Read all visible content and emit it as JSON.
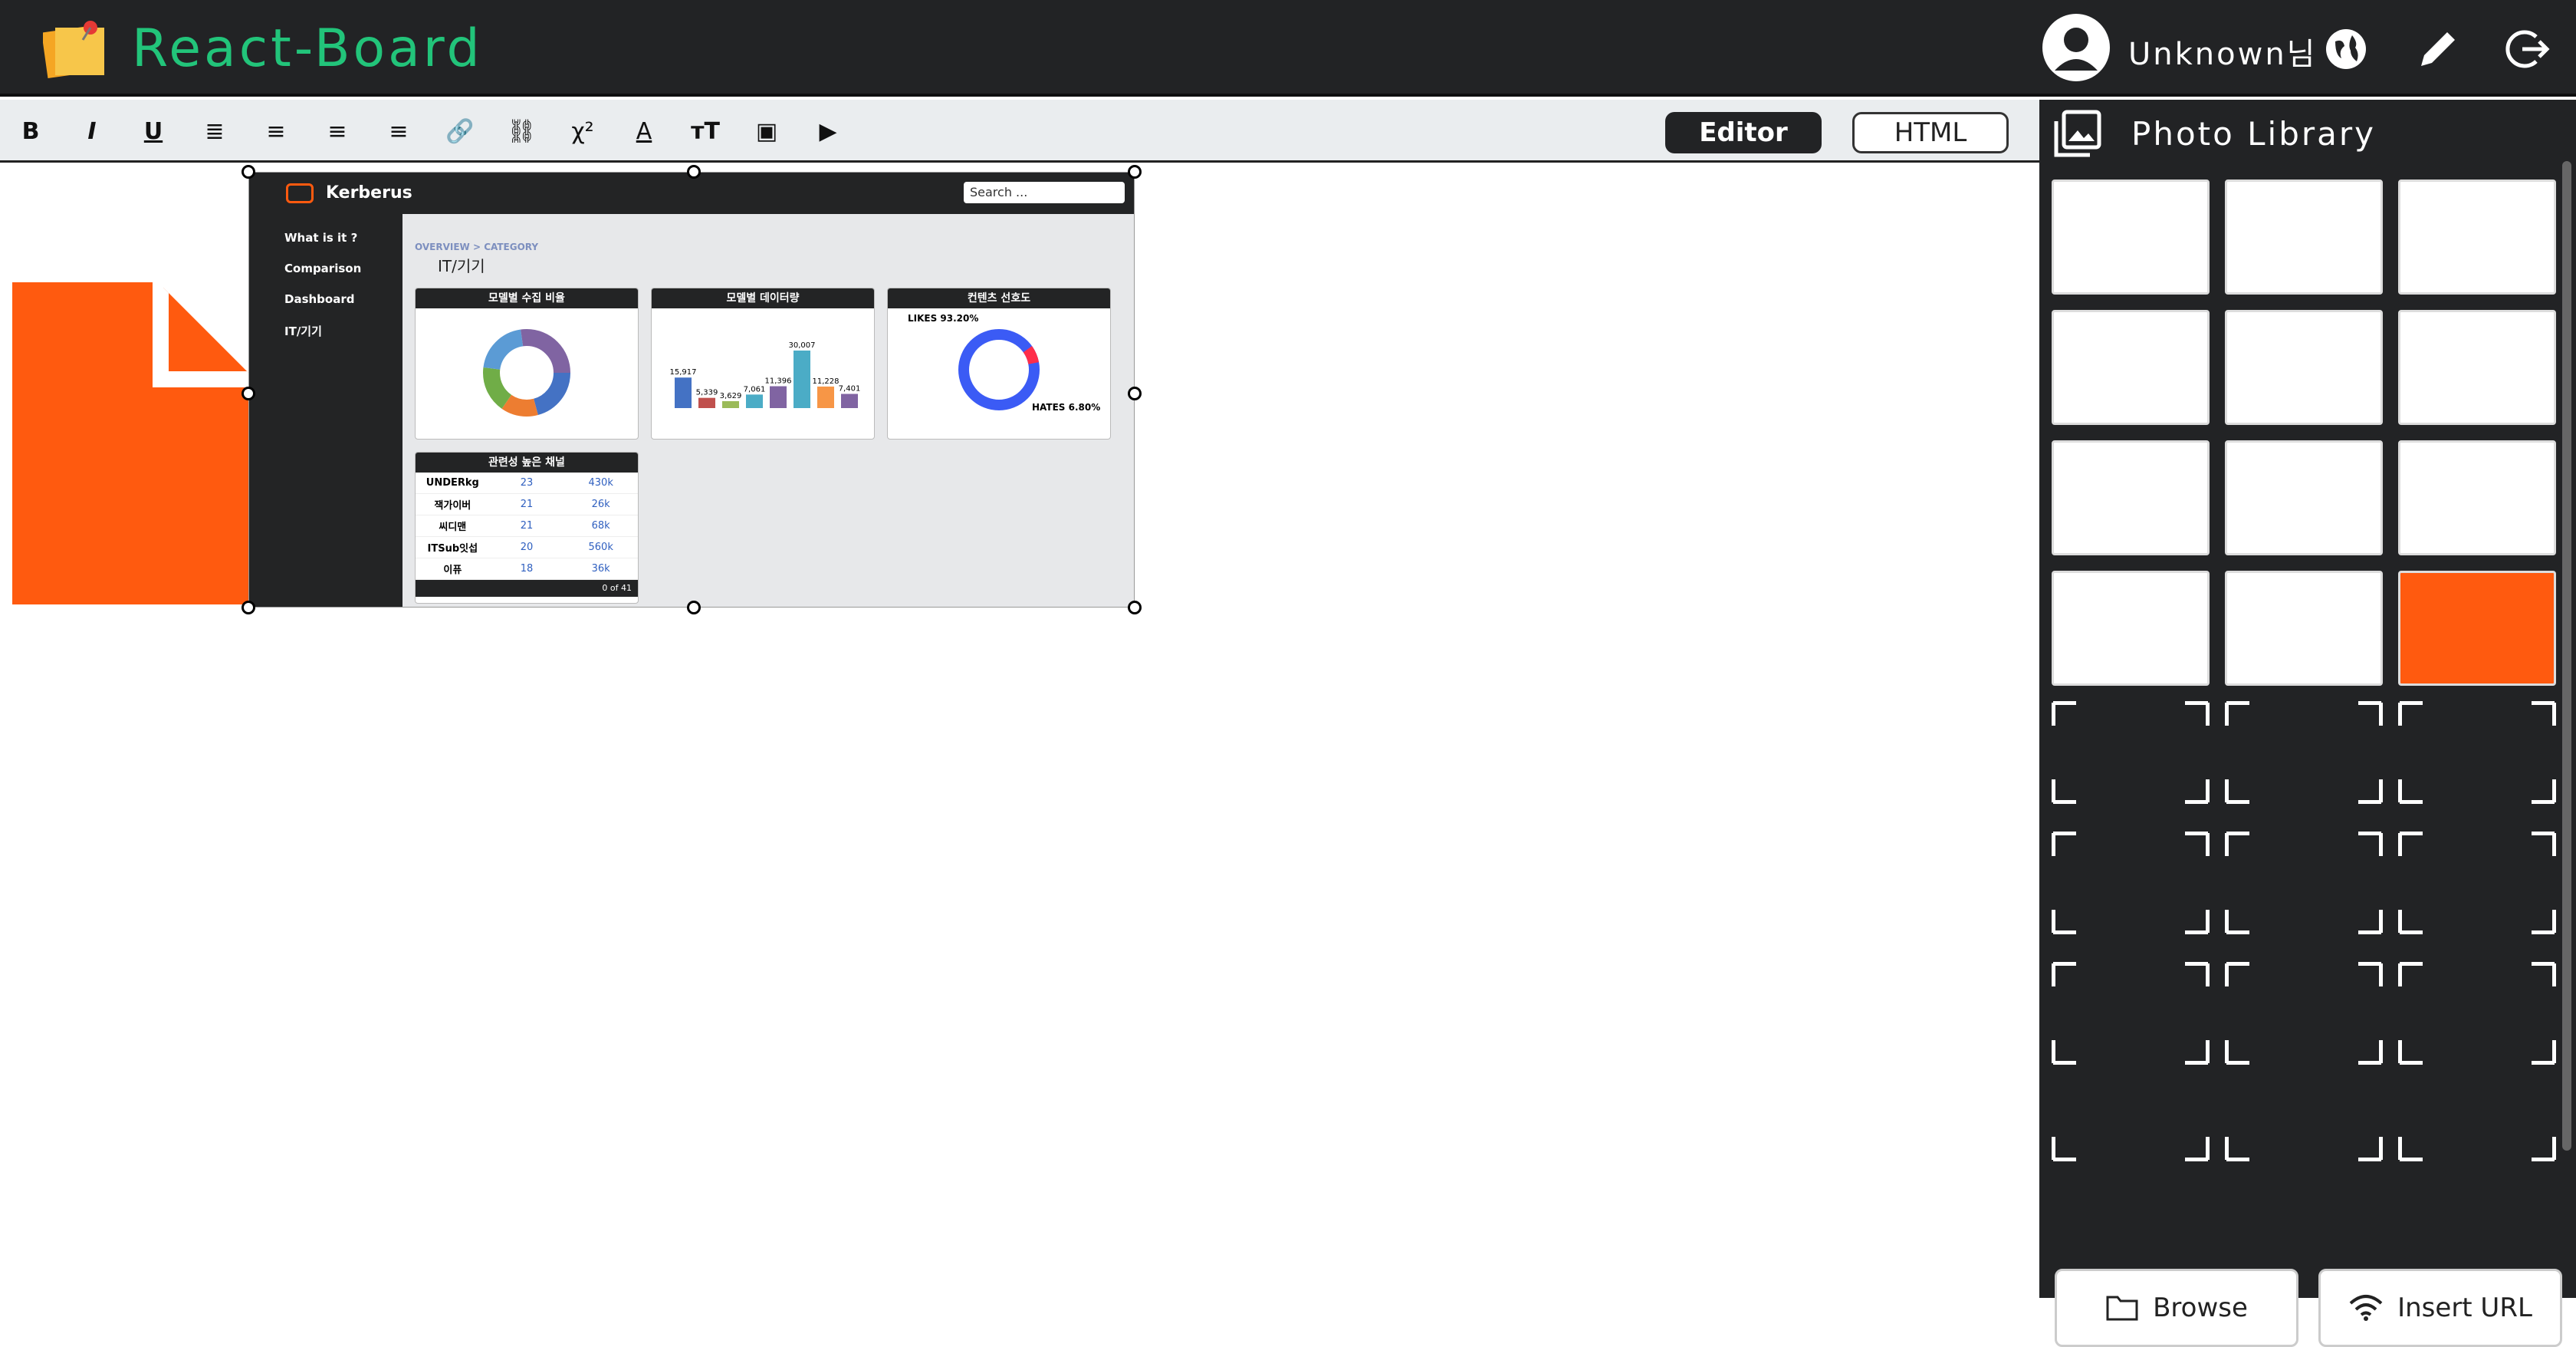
{
  "app": {
    "title": "React-Board"
  },
  "header": {
    "user_label": "Unknown님"
  },
  "toolbar": {
    "tools": [
      "B",
      "I",
      "U",
      "≣",
      "≡",
      "≡",
      "≡",
      "🔗",
      "⛓",
      "χ²",
      "A",
      "тT",
      "▣",
      "▶"
    ],
    "tab_editor": "Editor",
    "tab_html": "HTML"
  },
  "editor": {
    "embedded": {
      "brand": "Kerberus",
      "search_placeholder": "Search ...",
      "side_items": [
        "What is it ?",
        "Comparison",
        "Dashboard",
        "IT/기기"
      ],
      "breadcrumb": "OVERVIEW > CATEGORY",
      "page_title": "IT/기기",
      "card1_title": "모델별 수집 비율",
      "card2_title": "모델별 데이터량",
      "card3_title": "컨텐츠 선호도",
      "card4_title": "관련성 높은 채널",
      "bar_values": [
        "15,917",
        "5,339",
        "3,629",
        "7,061",
        "11,396",
        "30,007",
        "11,228",
        "7,401"
      ],
      "likes": "LIKES 93.20%",
      "hates": "HATES 6.80%",
      "channels": [
        {
          "name": "UNDERkg",
          "videos": "23",
          "subs": "430k"
        },
        {
          "name": "잭가이버",
          "videos": "21",
          "subs": "26k"
        },
        {
          "name": "씨디맨",
          "videos": "21",
          "subs": "68k"
        },
        {
          "name": "ITSub잇섭",
          "videos": "20",
          "subs": "560k"
        },
        {
          "name": "이퓨",
          "videos": "18",
          "subs": "36k"
        }
      ],
      "pager": "0 of 41"
    }
  },
  "panel": {
    "title": "Photo Library",
    "browse_label": "Browse",
    "insert_url_label": "Insert URL"
  },
  "colors": {
    "accent": "#22c47a",
    "dark": "#222325",
    "orange": "#ff5a0f"
  }
}
